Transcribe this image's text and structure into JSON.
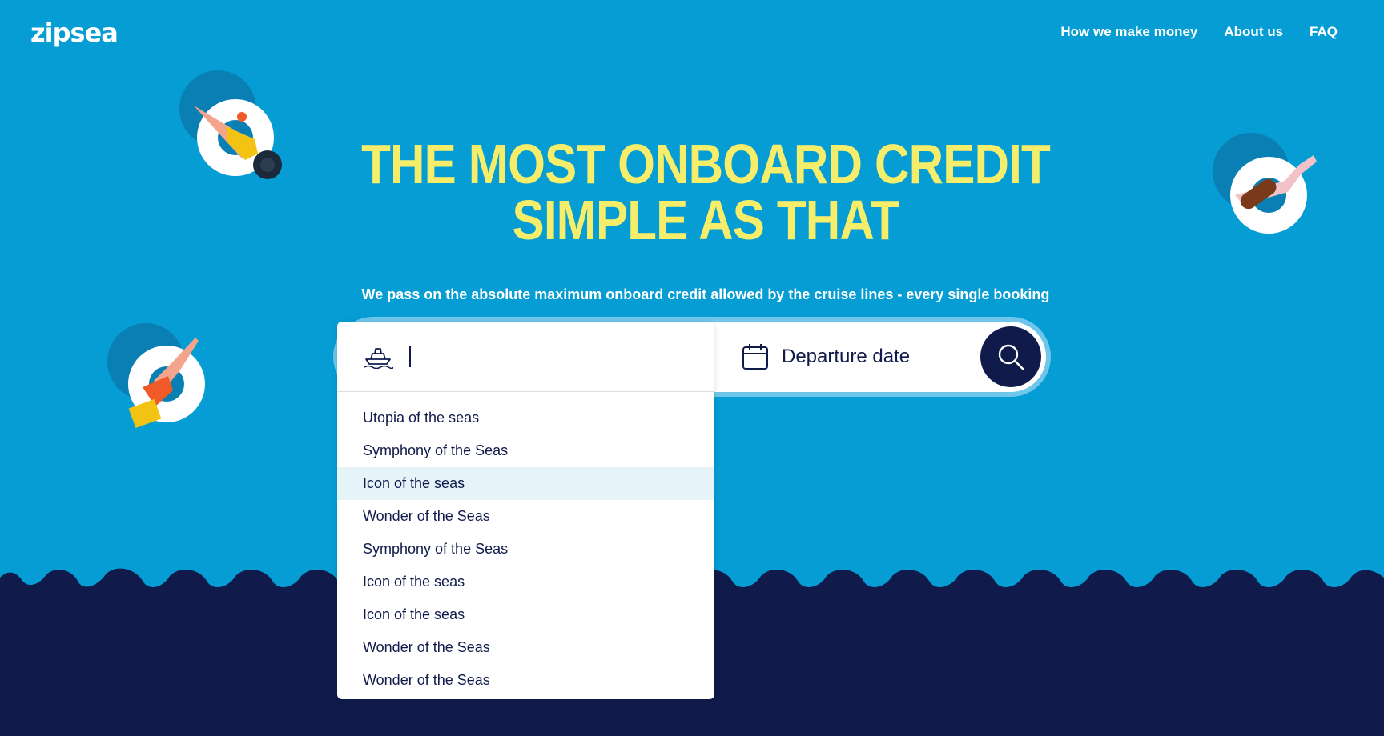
{
  "brand": {
    "logo_text": "zipsea"
  },
  "nav": {
    "items": [
      {
        "label": "How we make money"
      },
      {
        "label": "About us"
      },
      {
        "label": "FAQ"
      }
    ]
  },
  "hero": {
    "headline_line1": "THE MOST ONBOARD CREDIT",
    "headline_line2": "SIMPLE AS THAT",
    "subtitle": "We pass on the absolute maximum onboard credit allowed by the cruise lines - every single booking"
  },
  "search": {
    "ship_input_value": "",
    "ship_icon": "ship-icon",
    "date_label": "Departure date",
    "date_icon": "calendar-icon",
    "search_icon": "search-icon"
  },
  "ship_suggestions": [
    {
      "label": "Utopia of the seas",
      "highlighted": false
    },
    {
      "label": "Symphony of the Seas",
      "highlighted": false
    },
    {
      "label": "Icon of the seas",
      "highlighted": true
    },
    {
      "label": "Wonder of the Seas",
      "highlighted": false
    },
    {
      "label": "Symphony of the Seas",
      "highlighted": false
    },
    {
      "label": "Icon of the seas",
      "highlighted": false
    },
    {
      "label": "Icon of the seas",
      "highlighted": false
    },
    {
      "label": "Wonder of the Seas",
      "highlighted": false
    },
    {
      "label": "Wonder of the Seas",
      "highlighted": false
    }
  ],
  "colors": {
    "sky": "#059dd4",
    "sea": "#101b4b",
    "headline": "#f6ee6a",
    "highlight_row": "#e6f4fa"
  }
}
